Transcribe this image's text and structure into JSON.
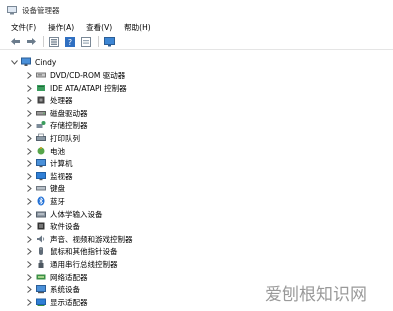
{
  "window": {
    "title": "设备管理器"
  },
  "menu": [
    "文件(F)",
    "操作(A)",
    "查看(V)",
    "帮助(H)"
  ],
  "toolbar": {
    "buttons": [
      "back-arrow-icon",
      "forward-arrow-icon",
      "grid-view-icon",
      "help-icon",
      "properties-icon",
      "monitor-icon"
    ]
  },
  "tree": {
    "root": "Cindy",
    "items": [
      {
        "label": "DVD/CD-ROM 驱动器",
        "icon": "dvd-drive-icon"
      },
      {
        "label": "IDE ATA/ATAPI 控制器",
        "icon": "ide-controller-icon"
      },
      {
        "label": "处理器",
        "icon": "processor-icon"
      },
      {
        "label": "磁盘驱动器",
        "icon": "disk-drive-icon"
      },
      {
        "label": "存储控制器",
        "icon": "storage-controller-icon"
      },
      {
        "label": "打印队列",
        "icon": "print-queue-icon"
      },
      {
        "label": "电池",
        "icon": "battery-icon"
      },
      {
        "label": "计算机",
        "icon": "computer-icon"
      },
      {
        "label": "监视器",
        "icon": "monitor-icon"
      },
      {
        "label": "键盘",
        "icon": "keyboard-icon"
      },
      {
        "label": "蓝牙",
        "icon": "bluetooth-icon"
      },
      {
        "label": "人体学输入设备",
        "icon": "hid-icon"
      },
      {
        "label": "软件设备",
        "icon": "software-device-icon"
      },
      {
        "label": "声音、视频和游戏控制器",
        "icon": "sound-icon"
      },
      {
        "label": "鼠标和其他指针设备",
        "icon": "mouse-icon"
      },
      {
        "label": "通用串行总线控制器",
        "icon": "usb-icon"
      },
      {
        "label": "网络适配器",
        "icon": "network-adapter-icon"
      },
      {
        "label": "系统设备",
        "icon": "system-device-icon"
      },
      {
        "label": "显示适配器",
        "icon": "display-adapter-icon"
      }
    ]
  },
  "watermark": "爱刨根知识网"
}
